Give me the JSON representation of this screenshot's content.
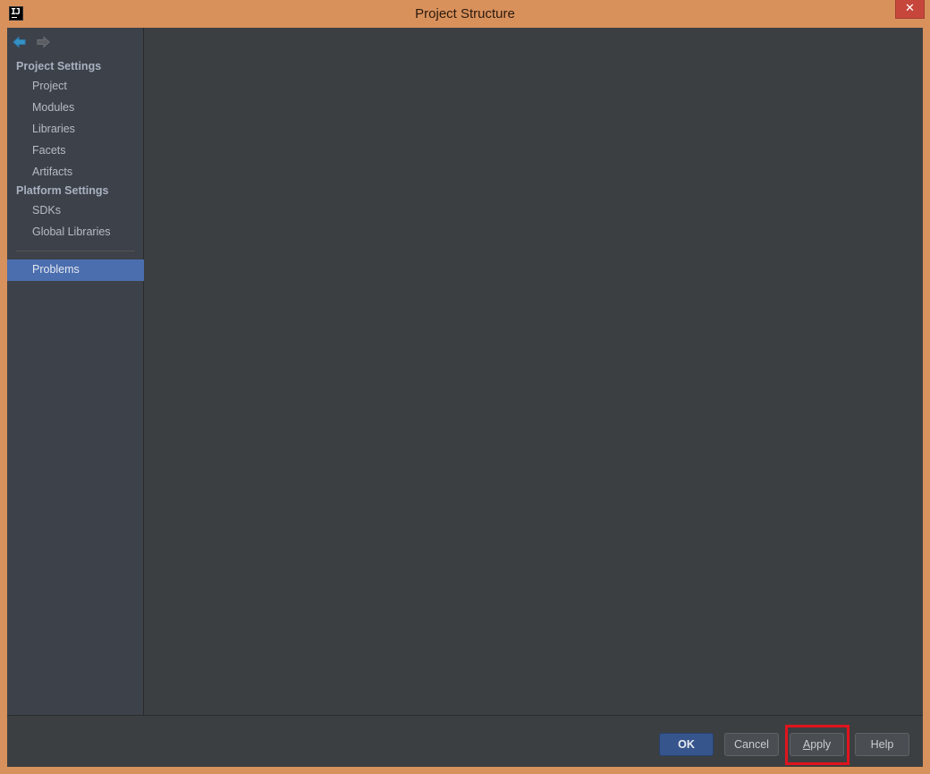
{
  "window": {
    "title": "Project Structure",
    "close_glyph": "✕",
    "app_icon_text": "IJ"
  },
  "sidebar": {
    "sections": [
      {
        "label": "Project Settings",
        "items": [
          "Project",
          "Modules",
          "Libraries",
          "Facets",
          "Artifacts"
        ]
      },
      {
        "label": "Platform Settings",
        "items": [
          "SDKs",
          "Global Libraries"
        ]
      }
    ],
    "selected_item": "Problems",
    "nav": {
      "back_icon": "arrow-left-icon",
      "forward_icon": "arrow-right-icon"
    }
  },
  "buttons": {
    "ok": "OK",
    "cancel": "Cancel",
    "apply_mnemonic": "A",
    "apply_rest": "pply",
    "help": "Help"
  },
  "colors": {
    "window_frame": "#d9915c",
    "selection": "#4b6eaf",
    "highlight_box": "#e0141e",
    "default_button": "#36558c"
  }
}
